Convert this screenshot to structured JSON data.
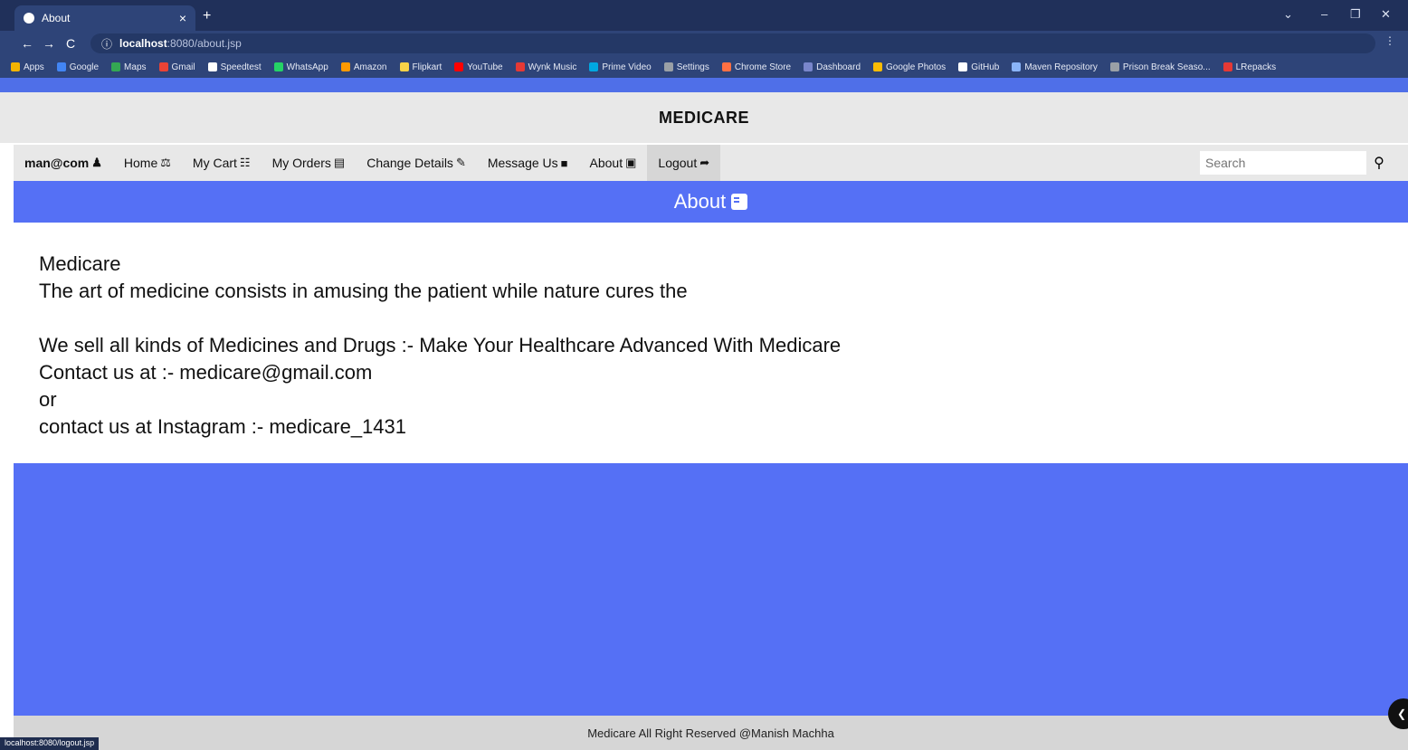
{
  "browser": {
    "tab_title": "About",
    "tab_close": "×",
    "new_tab": "+",
    "url_host": "localhost",
    "url_path": ":8080/about.jsp",
    "back": "←",
    "forward": "→",
    "reload": "C",
    "info": "ⓘ",
    "menu": "⋮",
    "win_min": "–",
    "win_max": "❐",
    "win_close": "✕",
    "win_chevron": "⌄",
    "bookmarks": [
      "Apps",
      "Google",
      "Maps",
      "Gmail",
      "Speedtest",
      "WhatsApp",
      "Amazon",
      "Flipkart",
      "YouTube",
      "Wynk Music",
      "Prime Video",
      "Settings",
      "Chrome Store",
      "Dashboard",
      "Google Photos",
      "GitHub",
      "Maven Repository",
      "Prison Break Seaso...",
      "LRepacks"
    ],
    "status_url": "localhost:8080/logout.jsp"
  },
  "site": {
    "title": "MEDICARE"
  },
  "nav": {
    "user": "man@com",
    "home": "Home",
    "cart": "My Cart",
    "orders": "My Orders",
    "change": "Change Details",
    "message": "Message Us",
    "about": "About",
    "logout": "Logout",
    "search_placeholder": "Search"
  },
  "banner": {
    "title": "About"
  },
  "content": {
    "line1": "Medicare",
    "line2": "The art of medicine consists in amusing the patient while nature cures the",
    "line3": "We sell all kinds of Medicines and Drugs :- Make Your Healthcare Advanced With Medicare",
    "line4": "Contact us at :- medicare@gmail.com",
    "line5": "or",
    "line6": "contact us at Instagram :- medicare_1431"
  },
  "footer": {
    "text": "Medicare All Right Reserved @Manish Machha"
  },
  "colors": {
    "accent": "#5570f5",
    "chrome": "#2e4478",
    "header": "#e8e8e8"
  }
}
